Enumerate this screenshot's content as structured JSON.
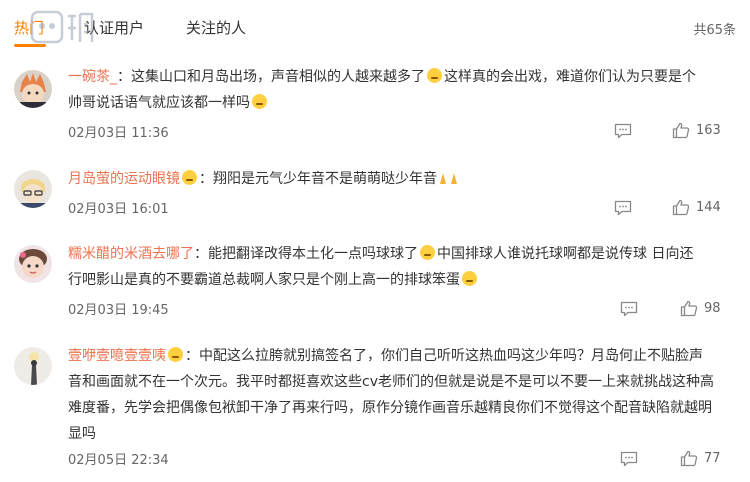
{
  "tabs": [
    {
      "label": "热门"
    },
    {
      "label": "认证用户"
    },
    {
      "label": "关注的人"
    }
  ],
  "total_count": "共65条",
  "comments": [
    {
      "username": "一碗茶_",
      "sep": "：",
      "text_a": "这集山口和月岛出场，声音相似的人越来越多了",
      "text_b": "这样真的会出戏，难道你们认为只要是个",
      "text_c": "帅哥说话语气就应该都一样吗",
      "time": "02月03日 11:36",
      "likes": "163"
    },
    {
      "username": "月岛萤的运动眼镜",
      "sep": "：",
      "text_a": "翔阳是元气少年音不是萌萌哒少年音",
      "time": "02月03日 16:01",
      "likes": "144"
    },
    {
      "username": "糯米醋的米酒去哪了",
      "sep": "：",
      "text_a": "能把翻译改得本土化一点吗球球了",
      "text_b": "中国排球人谁说托球啊都是说传球 日向还",
      "text_c": "行吧影山是真的不要霸道总裁啊人家只是个刚上高一的排球笨蛋",
      "time": "02月03日 19:45",
      "likes": "98"
    },
    {
      "username": "壹咿壹噫壹壹咦",
      "sep": "：",
      "text_a": "中配这么拉胯就别搞签名了，你们自己听听这热血吗这少年吗？月岛何止不贴脸声",
      "text_b": "音和画面就不在一个次元。我平时都挺喜欢这些cv老师们的但就是说是不是可以不要一上来就挑战这种高",
      "text_c": "难度番，先学会把偶像包袱卸干净了再来行吗，原作分镜作画音乐越精良你们不觉得这个配音缺陷就越明",
      "text_d": "显吗",
      "time": "02月05日 22:34",
      "likes": "77"
    }
  ],
  "colors": {
    "accent": "#ff8200",
    "username": "#eb7350",
    "meta": "#666666"
  }
}
